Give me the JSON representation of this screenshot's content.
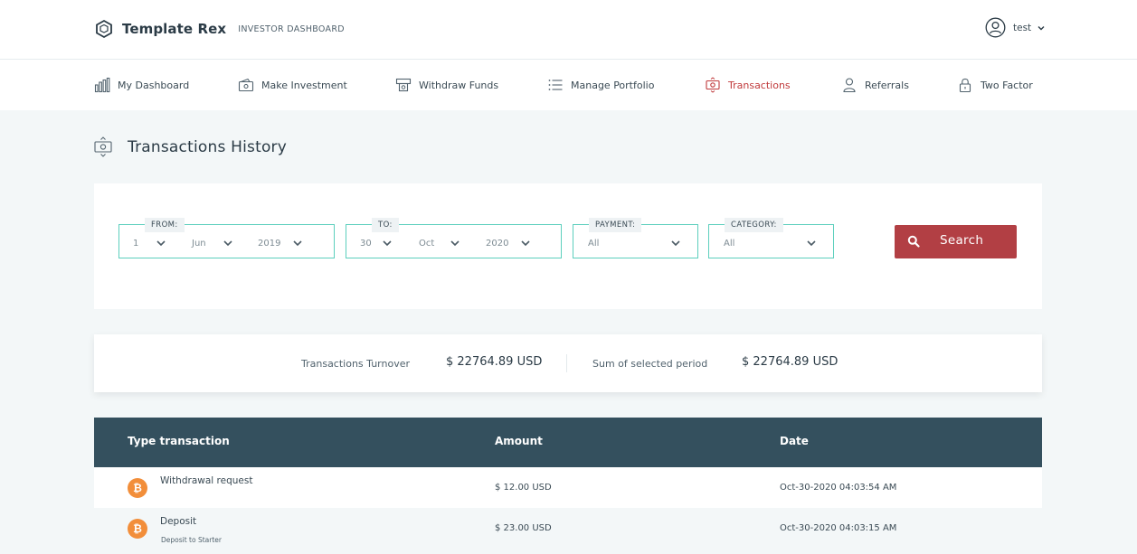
{
  "header": {
    "brand_name": "Template Rex",
    "brand_sub": "INVESTOR DASHBOARD",
    "user_name": "test"
  },
  "nav": {
    "items": [
      {
        "label": "My Dashboard",
        "icon": "bar-chart-icon"
      },
      {
        "label": "Make Investment",
        "icon": "wallet-icon"
      },
      {
        "label": "Withdraw Funds",
        "icon": "atm-icon"
      },
      {
        "label": "Manage Portfolio",
        "icon": "list-icon"
      },
      {
        "label": "Transactions",
        "icon": "money-transfer-icon",
        "active": true
      },
      {
        "label": "Referrals",
        "icon": "user-icon"
      },
      {
        "label": "Two Factor",
        "icon": "lock-icon"
      }
    ],
    "active_color": "#c0393b"
  },
  "page": {
    "title": "Transactions History"
  },
  "filters": {
    "from": {
      "legend": "FROM:",
      "day": "1",
      "month": "Jun",
      "year": "2019"
    },
    "to": {
      "legend": "TO:",
      "day": "30",
      "month": "Oct",
      "year": "2020"
    },
    "payment": {
      "legend": "PAYMENT:",
      "value": "All"
    },
    "category": {
      "legend": "CATEGORY:",
      "value": "All"
    },
    "search_label": "Search",
    "accent": "#5ccfbd",
    "button_color": "#b23f44"
  },
  "summary": {
    "turnover_label": "Transactions Turnover",
    "turnover_value": "$ 22764.89 USD",
    "period_label": "Sum of selected period",
    "period_value": "$ 22764.89 USD"
  },
  "table": {
    "headers": [
      "Type transaction",
      "Amount",
      "Date"
    ],
    "header_color": "#34505e",
    "rows": [
      {
        "type": "Withdrawal request",
        "sub": "",
        "amount": "$ 12.00 USD",
        "date": "Oct-30-2020 04:03:54 AM",
        "coin_icon": "bitcoin-icon"
      },
      {
        "type": "Deposit",
        "sub": "Deposit to Starter",
        "amount": "$ 23.00 USD",
        "date": "Oct-30-2020 04:03:15 AM",
        "coin_icon": "bitcoin-icon"
      }
    ]
  }
}
